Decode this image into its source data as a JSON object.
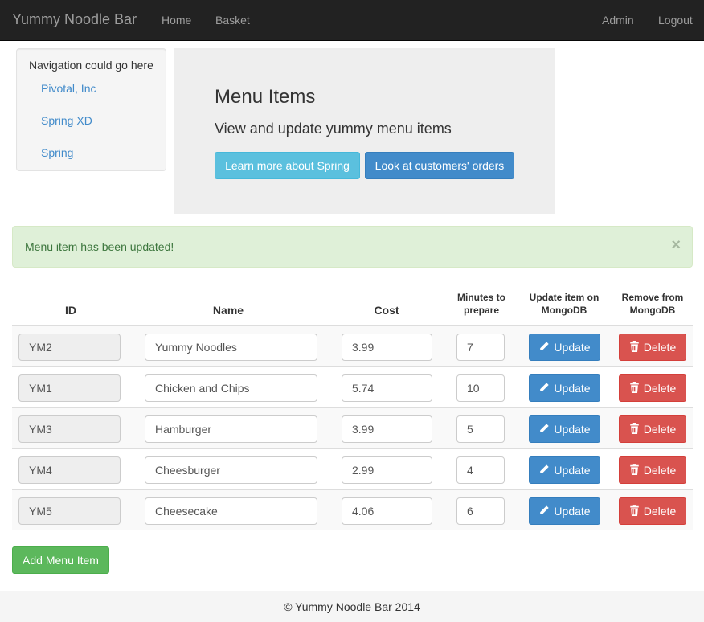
{
  "navbar": {
    "brand": "Yummy Noodle Bar",
    "links": [
      "Home",
      "Basket"
    ],
    "right_links": [
      "Admin",
      "Logout"
    ]
  },
  "sidebar": {
    "title": "Navigation could go here",
    "links": [
      "Pivotal, Inc",
      "Spring XD",
      "Spring"
    ]
  },
  "jumbotron": {
    "title": "Menu Items",
    "subtitle": "View and update yummy menu items",
    "btn_learn": "Learn more about Spring",
    "btn_orders": "Look at customers' orders"
  },
  "alert": {
    "message": "Menu item has been updated!",
    "close": "×"
  },
  "table": {
    "headers": {
      "id": "ID",
      "name": "Name",
      "cost": "Cost",
      "minutes_1": "Minutes to",
      "minutes_2": "prepare",
      "update_1": "Update item on",
      "update_2": "MongoDB",
      "remove_1": "Remove from",
      "remove_2": "MongoDB"
    },
    "update_label": "Update",
    "delete_label": "Delete",
    "rows": [
      {
        "id": "YM2",
        "name": "Yummy Noodles",
        "cost": "3.99",
        "minutes": "7"
      },
      {
        "id": "YM1",
        "name": "Chicken and Chips",
        "cost": "5.74",
        "minutes": "10"
      },
      {
        "id": "YM3",
        "name": "Hamburger",
        "cost": "3.99",
        "minutes": "5"
      },
      {
        "id": "YM4",
        "name": "Cheesburger",
        "cost": "2.99",
        "minutes": "4"
      },
      {
        "id": "YM5",
        "name": "Cheesecake",
        "cost": "4.06",
        "minutes": "6"
      }
    ]
  },
  "add_button": "Add Menu Item",
  "footer": "© Yummy Noodle Bar 2014",
  "icons": {
    "update": "pencil-icon",
    "delete": "trash-icon",
    "close": "close-icon"
  },
  "colors": {
    "primary": "#428bca",
    "info": "#5bc0de",
    "danger": "#d9534f",
    "success": "#5cb85c",
    "alert_bg": "#dff0d8",
    "alert_text": "#3c763d",
    "navbar": "#222222"
  }
}
